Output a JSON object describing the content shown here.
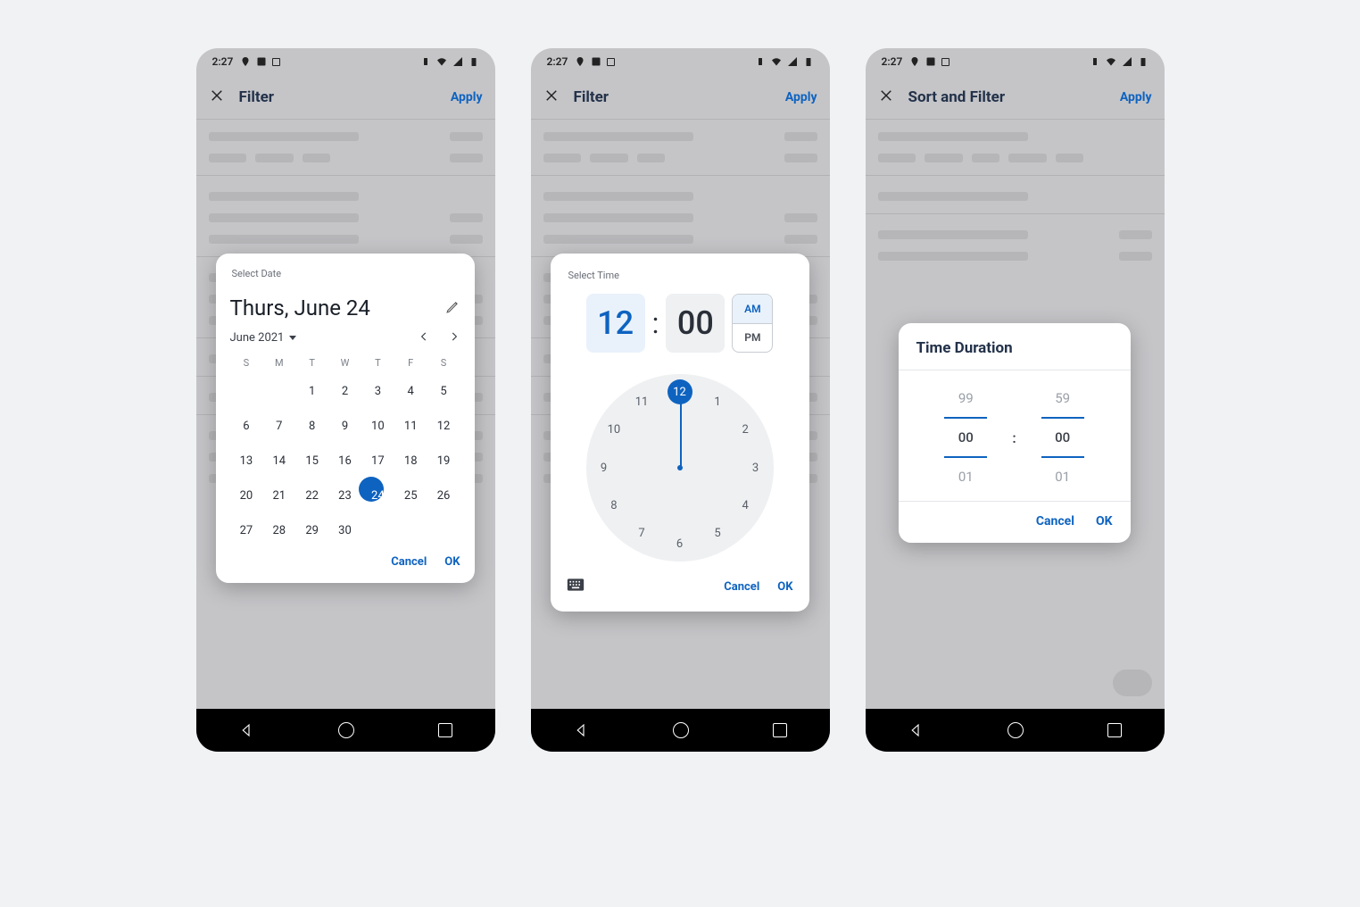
{
  "status": {
    "time": "2:27"
  },
  "screens": {
    "a": {
      "title": "Filter",
      "apply": "Apply"
    },
    "b": {
      "title": "Filter",
      "apply": "Apply"
    },
    "c": {
      "title": "Sort and Filter",
      "apply": "Apply"
    }
  },
  "date_picker": {
    "label": "Select Date",
    "selected_display": "Thurs, June 24",
    "month_label": "June 2021",
    "dow": [
      "S",
      "M",
      "T",
      "W",
      "T",
      "F",
      "S"
    ],
    "weeks": [
      [
        "",
        "",
        "1",
        "2",
        "3",
        "4",
        "5"
      ],
      [
        "6",
        "7",
        "8",
        "9",
        "10",
        "11",
        "12"
      ],
      [
        "13",
        "14",
        "15",
        "16",
        "17",
        "18",
        "19"
      ],
      [
        "20",
        "21",
        "22",
        "23",
        "24",
        "25",
        "26"
      ],
      [
        "27",
        "28",
        "29",
        "30",
        "",
        "",
        ""
      ]
    ],
    "selected_day": "24",
    "cancel": "Cancel",
    "ok": "OK"
  },
  "time_picker": {
    "label": "Select Time",
    "hour": "12",
    "minute": "00",
    "am": "AM",
    "pm": "PM",
    "clock_numbers": [
      "12",
      "1",
      "2",
      "3",
      "4",
      "5",
      "6",
      "7",
      "8",
      "9",
      "10",
      "11"
    ],
    "selected_hour": "12",
    "cancel": "Cancel",
    "ok": "OK"
  },
  "duration": {
    "title": "Time Duration",
    "hours_above": "99",
    "hours": "00",
    "hours_below": "01",
    "mins_above": "59",
    "mins": "00",
    "mins_below": "01",
    "cancel": "Cancel",
    "ok": "OK"
  }
}
